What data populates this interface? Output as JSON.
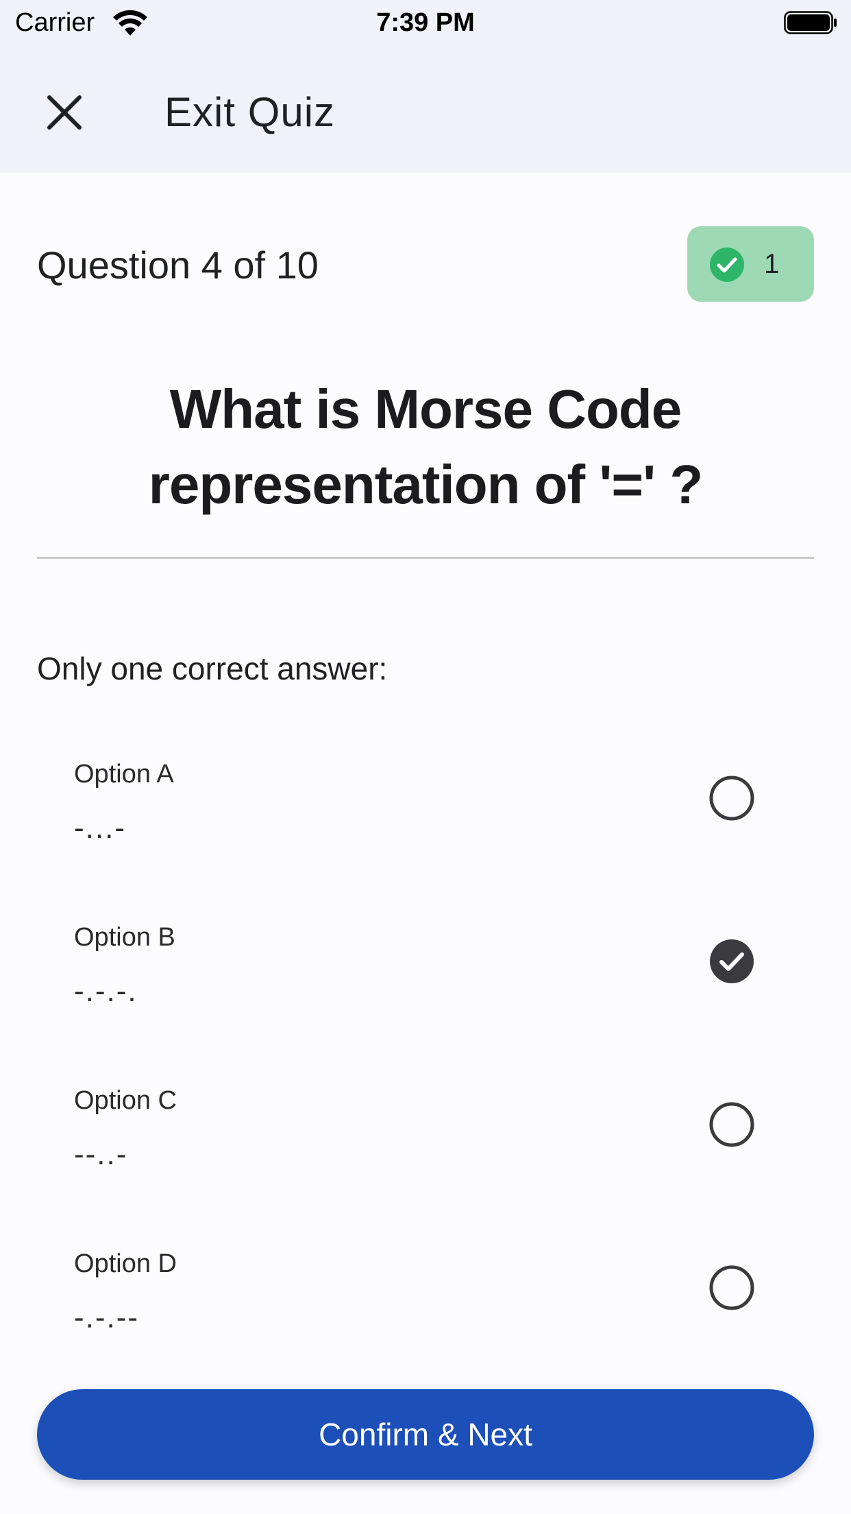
{
  "status_bar": {
    "carrier": "Carrier",
    "time": "7:39 PM"
  },
  "header": {
    "close_icon": "close-icon",
    "exit_label": "Exit Quiz"
  },
  "quiz": {
    "counter": "Question 4 of 10",
    "score": "1",
    "question_line1": "What is Morse Code",
    "question_line2": "representation of '=' ?",
    "instruction": "Only one correct answer:",
    "options": [
      {
        "label": "Option A",
        "value": "-...-",
        "selected": false
      },
      {
        "label": "Option B",
        "value": "-.-.-.",
        "selected": true
      },
      {
        "label": "Option C",
        "value": "--..-",
        "selected": false
      },
      {
        "label": "Option D",
        "value": "-.-.--",
        "selected": false
      }
    ],
    "confirm_label": "Confirm & Next"
  },
  "colors": {
    "accent": "#1c4fb7",
    "badge_bg": "#9dd9b4",
    "badge_check": "#2fb56a",
    "header_bg": "#f1f2f9",
    "selected_radio": "#3a3a3f"
  }
}
